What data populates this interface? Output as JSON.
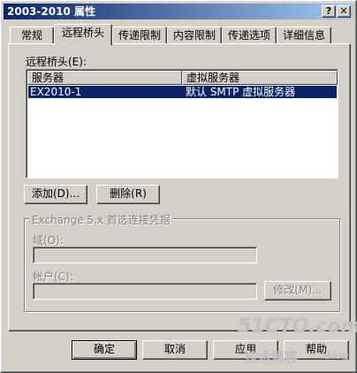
{
  "window": {
    "title": "2003-2010 属性",
    "help_glyph": "?",
    "close_glyph": "✕"
  },
  "tabs": [
    {
      "label": "常规"
    },
    {
      "label": "远程桥头"
    },
    {
      "label": "传递限制"
    },
    {
      "label": "内容限制"
    },
    {
      "label": "传递选项"
    },
    {
      "label": "详细信息"
    }
  ],
  "bridgehead": {
    "list_label": "远程桥头(E):",
    "columns": [
      "服务器",
      "虚拟服务器"
    ],
    "rows": [
      {
        "server": "EX2010-1",
        "virtual_server": "默认 SMTP 虚拟服务器",
        "selected": true
      }
    ]
  },
  "buttons": {
    "add": "添加(D)...",
    "remove": "删除(R)"
  },
  "exchange5": {
    "group_title": "Exchange 5.x 首选连接凭据",
    "domain_label": "域(O):",
    "account_label": "帐户(C):",
    "modify_button": "修改(M)..."
  },
  "footer": {
    "ok": "确定",
    "cancel": "取消",
    "apply": "应用",
    "help": "帮助"
  },
  "watermark": {
    "site": "51CTO.com",
    "tagline": "技术博客",
    "blog": "Blog"
  }
}
